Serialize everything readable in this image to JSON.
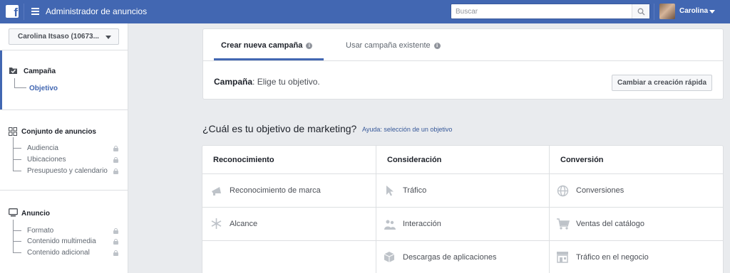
{
  "topbar": {
    "logo_icon": "facebook-logo-icon",
    "menu_icon": "hamburger-menu-icon",
    "title": "Administrador de anuncios",
    "search_placeholder": "Buscar",
    "search_icon": "search-icon",
    "user_name": "Carolina",
    "brand_color": "#4267b2"
  },
  "sidebar": {
    "account": "Carolina Itsaso (10673...",
    "sections": [
      {
        "icon": "folder-check-icon",
        "title": "Campaña",
        "items": [
          {
            "label": "Objetivo",
            "locked": false,
            "active": true
          }
        ]
      },
      {
        "icon": "grid-icon",
        "title": "Conjunto de anuncios",
        "items": [
          {
            "label": "Audiencia",
            "locked": true
          },
          {
            "label": "Ubicaciones",
            "locked": true
          },
          {
            "label": "Presupuesto y calendario",
            "locked": true
          }
        ]
      },
      {
        "icon": "monitor-icon",
        "title": "Anuncio",
        "items": [
          {
            "label": "Formato",
            "locked": true
          },
          {
            "label": "Contenido multimedia",
            "locked": true
          },
          {
            "label": "Contenido adicional",
            "locked": true
          }
        ]
      }
    ]
  },
  "campaign_card": {
    "tabs": [
      {
        "label": "Crear nueva campaña",
        "active": true
      },
      {
        "label": "Usar campaña existente",
        "active": false
      }
    ],
    "campaign_label": "Campaña",
    "campaign_text": ": Elige tu objetivo.",
    "quick_create_button": "Cambiar a creación rápida"
  },
  "objectives": {
    "question": "¿Cuál es tu objetivo de marketing?",
    "help_link": "Ayuda: selección de un objetivo",
    "columns": [
      {
        "title": "Reconocimiento",
        "items": [
          {
            "label": "Reconocimiento de marca",
            "icon": "megaphone-icon"
          },
          {
            "label": "Alcance",
            "icon": "snowflake-icon"
          }
        ]
      },
      {
        "title": "Consideración",
        "items": [
          {
            "label": "Tráfico",
            "icon": "cursor-icon"
          },
          {
            "label": "Interacción",
            "icon": "people-icon"
          },
          {
            "label": "Descargas de aplicaciones",
            "icon": "box-icon"
          }
        ]
      },
      {
        "title": "Conversión",
        "items": [
          {
            "label": "Conversiones",
            "icon": "globe-icon"
          },
          {
            "label": "Ventas del catálogo",
            "icon": "cart-icon"
          },
          {
            "label": "Tráfico en el negocio",
            "icon": "store-icon"
          }
        ]
      }
    ]
  }
}
